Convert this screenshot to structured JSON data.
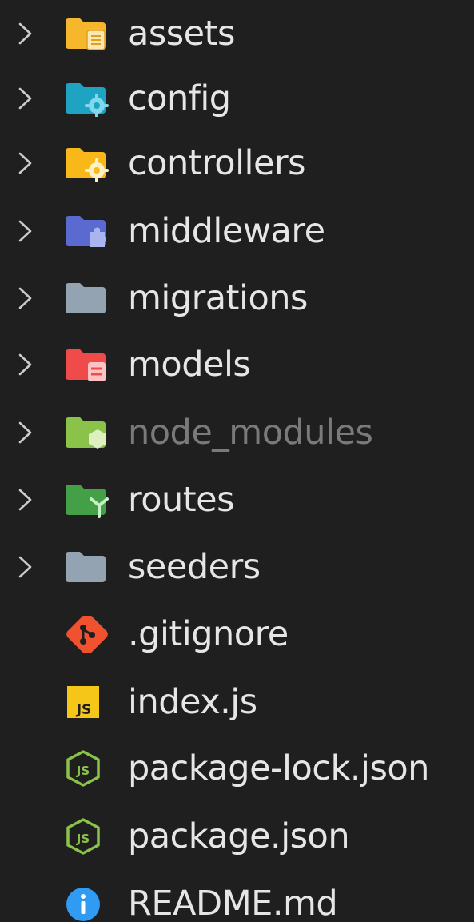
{
  "explorer": {
    "items": [
      {
        "label": "assets",
        "kind": "folder",
        "icon": "folder-assets-icon",
        "dim": false
      },
      {
        "label": "config",
        "kind": "folder",
        "icon": "folder-config-icon",
        "dim": false
      },
      {
        "label": "controllers",
        "kind": "folder",
        "icon": "folder-controllers-icon",
        "dim": false
      },
      {
        "label": "middleware",
        "kind": "folder",
        "icon": "folder-middleware-icon",
        "dim": false
      },
      {
        "label": "migrations",
        "kind": "folder",
        "icon": "folder-generic-icon",
        "dim": false
      },
      {
        "label": "models",
        "kind": "folder",
        "icon": "folder-models-icon",
        "dim": false
      },
      {
        "label": "node_modules",
        "kind": "folder",
        "icon": "folder-node-icon",
        "dim": true
      },
      {
        "label": "routes",
        "kind": "folder",
        "icon": "folder-routes-icon",
        "dim": false
      },
      {
        "label": "seeders",
        "kind": "folder",
        "icon": "folder-generic-icon",
        "dim": false
      },
      {
        "label": ".gitignore",
        "kind": "file",
        "icon": "git-icon",
        "dim": false
      },
      {
        "label": "index.js",
        "kind": "file",
        "icon": "javascript-icon",
        "dim": false
      },
      {
        "label": "package-lock.json",
        "kind": "file",
        "icon": "nodejs-icon",
        "dim": false
      },
      {
        "label": "package.json",
        "kind": "file",
        "icon": "nodejs-icon",
        "dim": false
      },
      {
        "label": "README.md",
        "kind": "file",
        "icon": "info-icon",
        "dim": false
      }
    ],
    "colors": {
      "background": "#1f1f1f",
      "text": "#e6e6e6",
      "text_dim": "#7a7a7a",
      "chevron": "#cccccc",
      "folder_assets": "#f6b72c",
      "folder_config": "#1ea3c2",
      "folder_controllers": "#f9b81a",
      "folder_middleware": "#5a6ad0",
      "folder_generic": "#94a3b2",
      "folder_models": "#ef4b4b",
      "folder_node": "#8bc34a",
      "folder_routes": "#43a047",
      "git": "#f0512f",
      "javascript": "#f5c518",
      "nodejs": "#8bc34a",
      "info": "#2f9bf2"
    }
  }
}
